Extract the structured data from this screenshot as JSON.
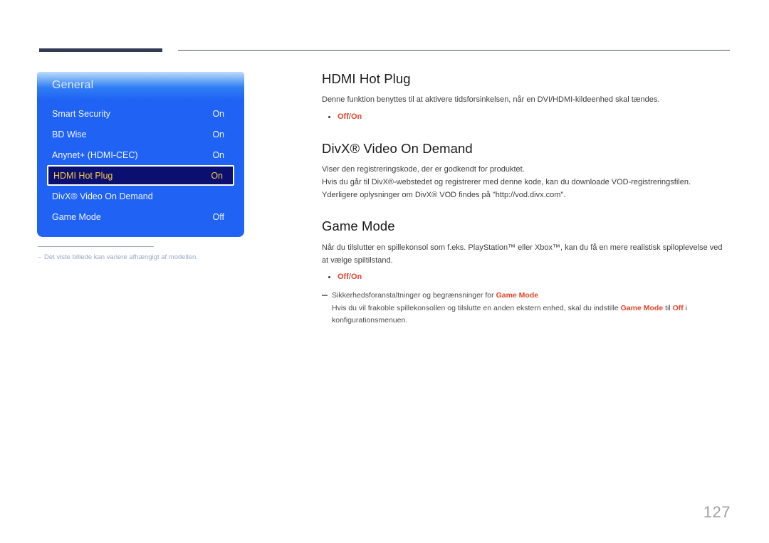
{
  "page": {
    "number": "127"
  },
  "osd": {
    "title": "General",
    "rows": [
      {
        "label": "Smart Security",
        "value": "On",
        "selected": false
      },
      {
        "label": "BD Wise",
        "value": "On",
        "selected": false
      },
      {
        "label": "Anynet+ (HDMI-CEC)",
        "value": "On",
        "selected": false
      },
      {
        "label": "HDMI Hot Plug",
        "value": "On",
        "selected": true
      },
      {
        "label": "DivX® Video On Demand",
        "value": "",
        "selected": false
      },
      {
        "label": "Game Mode",
        "value": "Off",
        "selected": false
      }
    ],
    "colors": {
      "panel_blue": "#1f62f4",
      "panel_top_light": "#b9ddfb",
      "selected_bg": "#0b1070",
      "selected_text": "#f7c948",
      "row_text": "#f2f6fd"
    }
  },
  "caption": {
    "dash": "–",
    "text": "Det viste billede kan variere afhængigt af modellen."
  },
  "sections": [
    {
      "id": "hdmi-hot-plug",
      "title": "HDMI Hot Plug",
      "paragraphs": [
        "Denne funktion benyttes til at aktivere tidsforsinkelsen, når en DVI/HDMI-kildeenhed skal tændes."
      ],
      "options": {
        "off": "Off",
        "separator": "/",
        "on": "On"
      }
    },
    {
      "id": "divx-video-on-demand",
      "title": "DivX® Video On Demand",
      "paragraphs": [
        "Viser den registreringskode, der er godkendt for produktet.",
        "Hvis du går til DivX®-webstedet og registrerer med denne kode, kan du downloade VOD-registreringsfilen.",
        "Yderligere oplysninger om DivX® VOD findes på \"http://vod.divx.com\"."
      ]
    },
    {
      "id": "game-mode",
      "title": "Game Mode",
      "paragraphs": [
        "Når du tilslutter en spillekonsol som f.eks. PlayStation™ eller Xbox™, kan du få en mere realistisk spiloplevelse ved at vælge spiltilstand."
      ],
      "options": {
        "off": "Off",
        "separator": "/",
        "on": "On"
      },
      "note": {
        "lead_before": "Sikkerhedsforanstaltninger og begrænsninger for ",
        "lead_highlight": "Game Mode",
        "body_part1": "Hvis du vil frakoble spillekonsollen og tilslutte en anden ekstern enhed, skal du indstille ",
        "body_highlight1": "Game Mode",
        "body_part2": " til ",
        "body_highlight2": "Off",
        "body_part3": " i konfigurationsmenuen."
      }
    }
  ],
  "theme": {
    "accent_orange": "#e8442a",
    "rule_dark": "#333a56",
    "page_number_gray": "#a0a0a0"
  }
}
